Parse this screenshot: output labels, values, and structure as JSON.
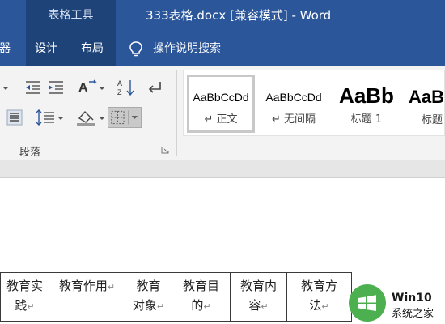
{
  "titlebar": {
    "contextual_tab_group": "表格工具",
    "document_title": "333表格.docx [兼容模式]  -  Word"
  },
  "tabs": [
    {
      "label": "器"
    },
    {
      "label": "设计"
    },
    {
      "label": "布局"
    },
    {
      "label": "操作说明搜索"
    }
  ],
  "ribbon": {
    "paragraph_group_label": "段落"
  },
  "styles_gallery": [
    {
      "sample": "AaBbCcDd",
      "name": "↵ 正文",
      "selected": true
    },
    {
      "sample": "AaBbCcDd",
      "name": "↵ 无间隔",
      "selected": false
    },
    {
      "sample": "AaBb",
      "name": "标题 1",
      "selected": false
    },
    {
      "sample": "AaB",
      "name": "标题",
      "selected": false
    }
  ],
  "table": {
    "header_cells": [
      {
        "line1": "教育实",
        "line2": "践"
      },
      {
        "line1": "教育作用",
        "line2": ""
      },
      {
        "line1": "教育",
        "line2": "对象"
      },
      {
        "line1": "教育目",
        "line2": "的"
      },
      {
        "line1": "教育内",
        "line2": "容"
      },
      {
        "line1": "教育方",
        "line2": "法"
      }
    ]
  },
  "watermark": {
    "title": "Win10",
    "subtitle": "系统之家"
  }
}
